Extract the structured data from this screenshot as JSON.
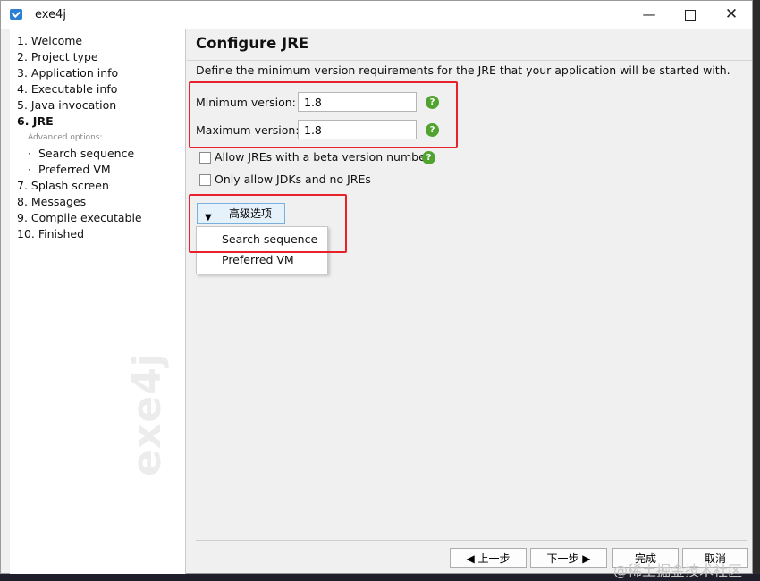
{
  "window": {
    "title": "exe4j",
    "minimize": "—",
    "close": "✕"
  },
  "sidebar": {
    "items": [
      {
        "label": "1. Welcome"
      },
      {
        "label": "2. Project type"
      },
      {
        "label": "3. Application info"
      },
      {
        "label": "4. Executable info"
      },
      {
        "label": "5. Java invocation"
      },
      {
        "label": "6. JRE"
      }
    ],
    "advanced_label": "Advanced options:",
    "sub_items": [
      {
        "label": "Search sequence"
      },
      {
        "label": "Preferred VM"
      }
    ],
    "items_after": [
      {
        "label": "7. Splash screen"
      },
      {
        "label": "8. Messages"
      },
      {
        "label": "9. Compile executable"
      },
      {
        "label": "10. Finished"
      }
    ],
    "watermark": "exe4j"
  },
  "main": {
    "title": "Configure JRE",
    "description": "Define the minimum version requirements for the JRE that your application will be started with.",
    "min_label": "Minimum version:",
    "min_value": "1.8",
    "max_label": "Maximum version:",
    "max_value": "1.8",
    "help_glyph": "?",
    "beta_label": "Allow JREs with a beta version number",
    "jdk_label": "Only allow JDKs and no JREs",
    "advanced_button": "高级选项",
    "dropdown": [
      {
        "label": "Search sequence"
      },
      {
        "label": "Preferred VM"
      }
    ]
  },
  "footer": {
    "back": "◀  上一步",
    "next": "下一步  ▶",
    "finish": "完成",
    "cancel": "取消"
  },
  "overlay": {
    "site_watermark": "@稀土掘金技术社区"
  },
  "colors": {
    "highlight": "#e8222b",
    "help": "#4fa32e",
    "accent": "#2a7fd4"
  }
}
